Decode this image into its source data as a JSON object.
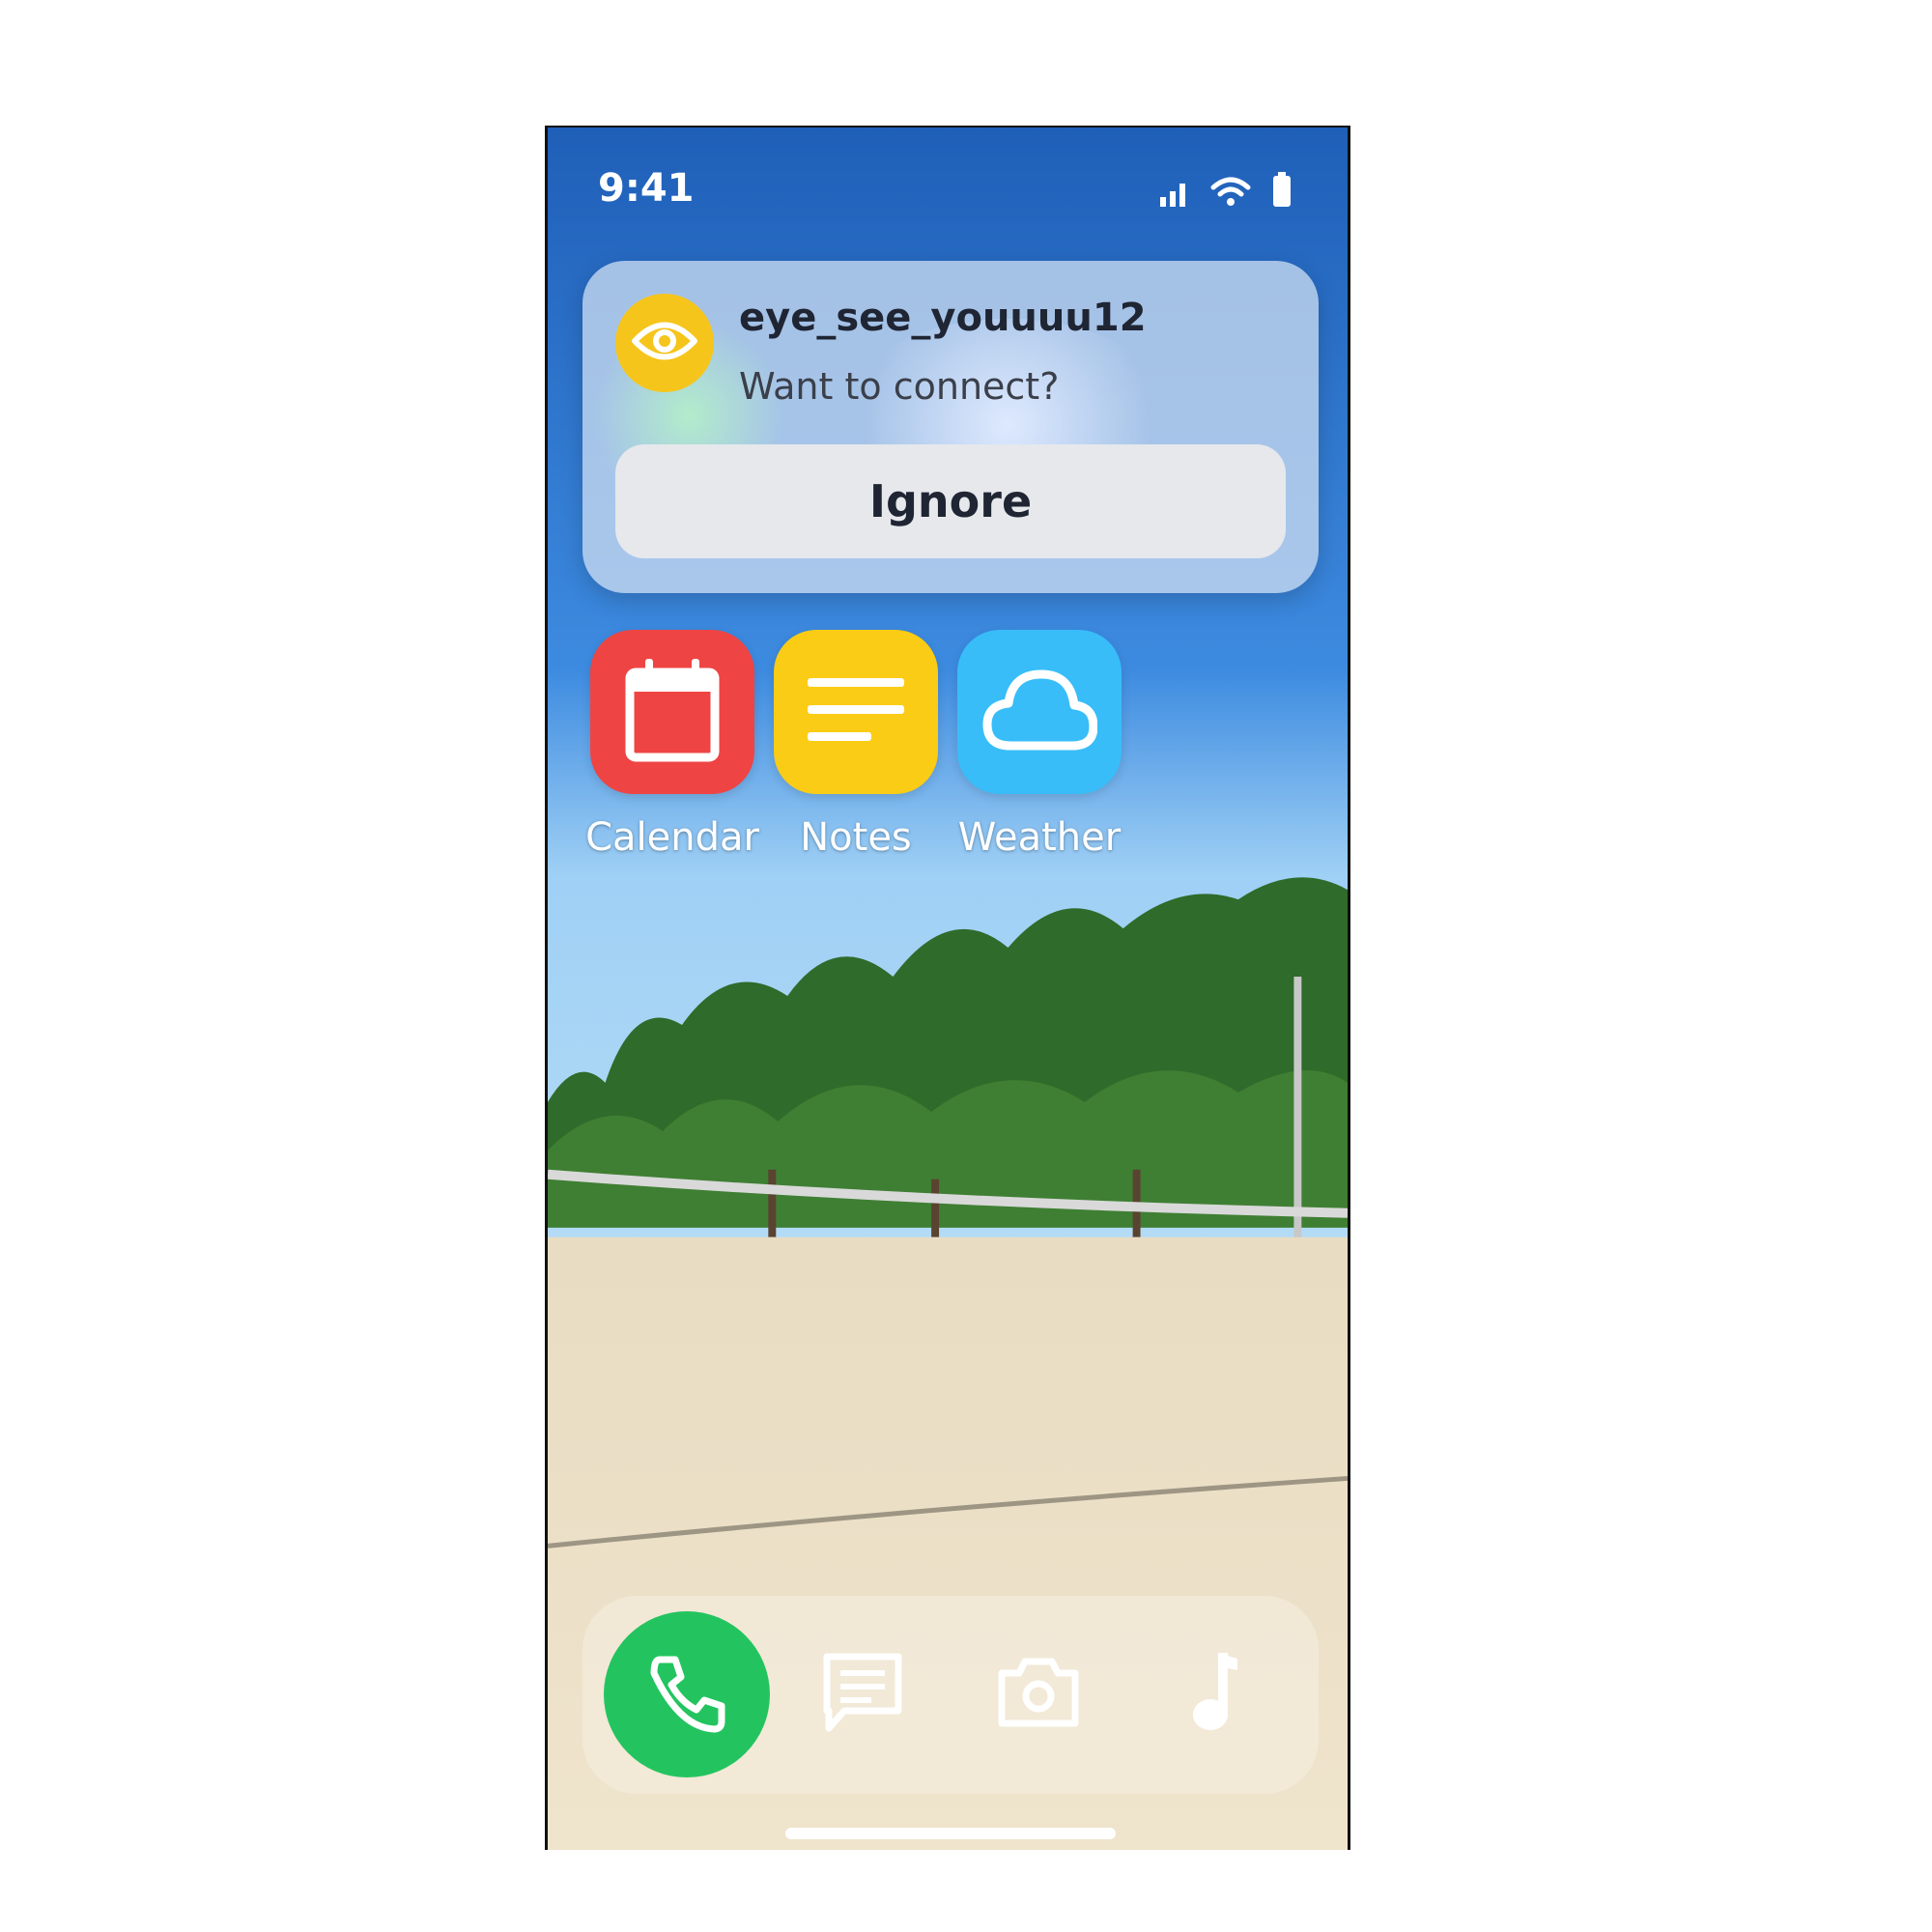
{
  "status_bar": {
    "time": "9:41"
  },
  "notification": {
    "sender": "eye_see_youuuu12",
    "message": "Want to connect?",
    "ignore_label": "Ignore",
    "avatar_icon": "eye-icon",
    "avatar_color": "#f6c51c"
  },
  "apps": [
    {
      "label": "Calendar",
      "icon": "calendar-icon",
      "color": "#ef4444"
    },
    {
      "label": "Notes",
      "icon": "notes-icon",
      "color": "#facc15"
    },
    {
      "label": "Weather",
      "icon": "cloud-icon",
      "color": "#38bdf8"
    }
  ],
  "dock": {
    "items": [
      {
        "icon": "phone-icon",
        "color": "#23c45f"
      },
      {
        "icon": "message-icon"
      },
      {
        "icon": "camera-icon"
      },
      {
        "icon": "music-icon"
      }
    ]
  }
}
